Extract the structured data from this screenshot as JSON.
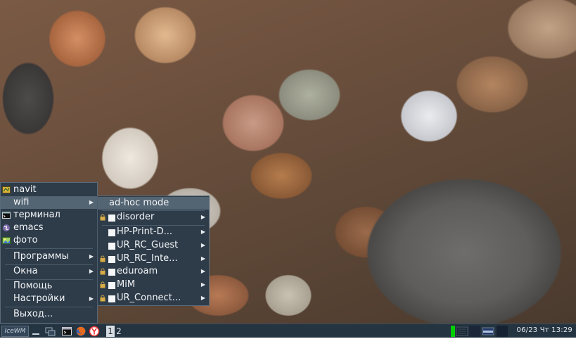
{
  "desktop": {
    "wallpaper": "pebbles"
  },
  "start_menu": {
    "items": [
      {
        "label": "navit",
        "icon": "map-icon"
      },
      {
        "label": "wifi",
        "icon": "none",
        "submenu": true
      },
      {
        "label": "терминал",
        "icon": "terminal-icon"
      },
      {
        "label": "emacs",
        "icon": "emacs-icon"
      },
      {
        "label": "фото",
        "icon": "image-icon"
      },
      {
        "label": "Программы",
        "submenu": true
      },
      {
        "label": "Окна",
        "submenu": true
      },
      {
        "label": "Помощь"
      },
      {
        "label": "Настройки",
        "submenu": true
      },
      {
        "label": "Выход..."
      }
    ]
  },
  "wifi_menu": {
    "items": [
      {
        "label": "ad-hoc mode"
      },
      {
        "label": "disorder",
        "locked": true,
        "submenu": true
      },
      {
        "label": "HP-Print-D...",
        "locked": false,
        "submenu": true
      },
      {
        "label": "UR_RC_Guest",
        "locked": false,
        "submenu": true
      },
      {
        "label": "UR_RC_Inte...",
        "locked": true,
        "submenu": true
      },
      {
        "label": "eduroam",
        "locked": true,
        "submenu": true
      },
      {
        "label": "MiM",
        "locked": true,
        "submenu": true
      },
      {
        "label": "UR_Connect...",
        "locked": true,
        "submenu": true
      }
    ]
  },
  "taskbar": {
    "start_label": "IceWM",
    "workspaces": [
      "1",
      "2"
    ],
    "active_workspace": "1",
    "clock": "06/23 Чт 13:29",
    "accent_color": "#00d000"
  }
}
